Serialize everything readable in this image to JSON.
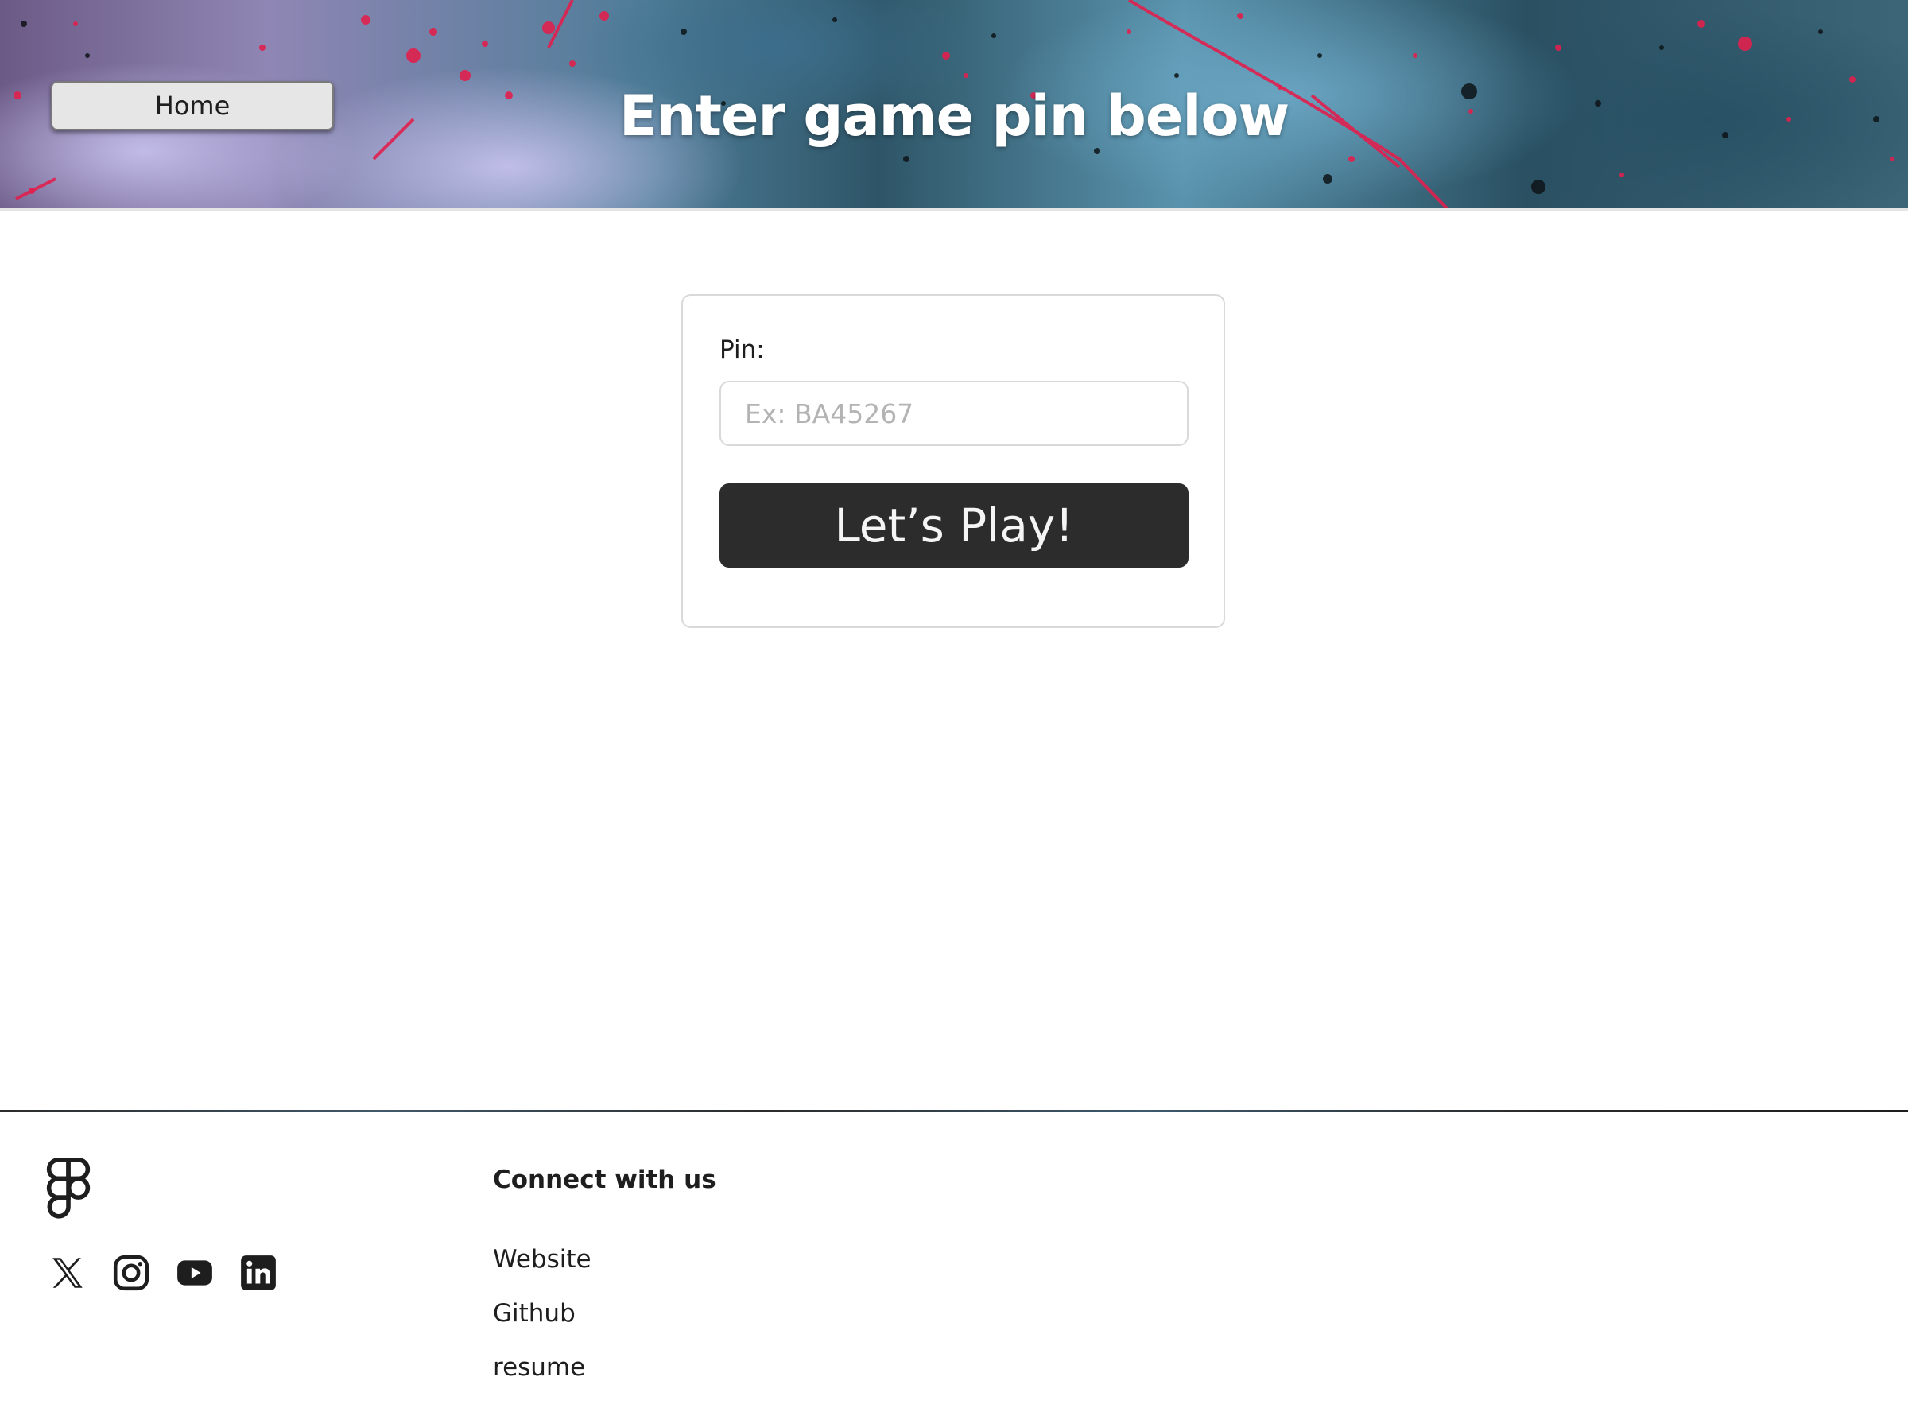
{
  "header": {
    "home_label": "Home",
    "title": "Enter game pin below"
  },
  "pin_form": {
    "label": "Pin:",
    "placeholder": "Ex: BA45267",
    "value": "",
    "submit_label": "Let’s Play!"
  },
  "footer": {
    "logo_icon": "figma-logo-icon",
    "social_icons": [
      "x-icon",
      "instagram-icon",
      "youtube-icon",
      "linkedin-icon"
    ],
    "heading": "Connect with us",
    "links": [
      "Website",
      "Github",
      "resume"
    ]
  },
  "colors": {
    "button_dark": "#2c2c2c",
    "border_light": "#d9d9d9",
    "text": "#1e1e1e"
  }
}
